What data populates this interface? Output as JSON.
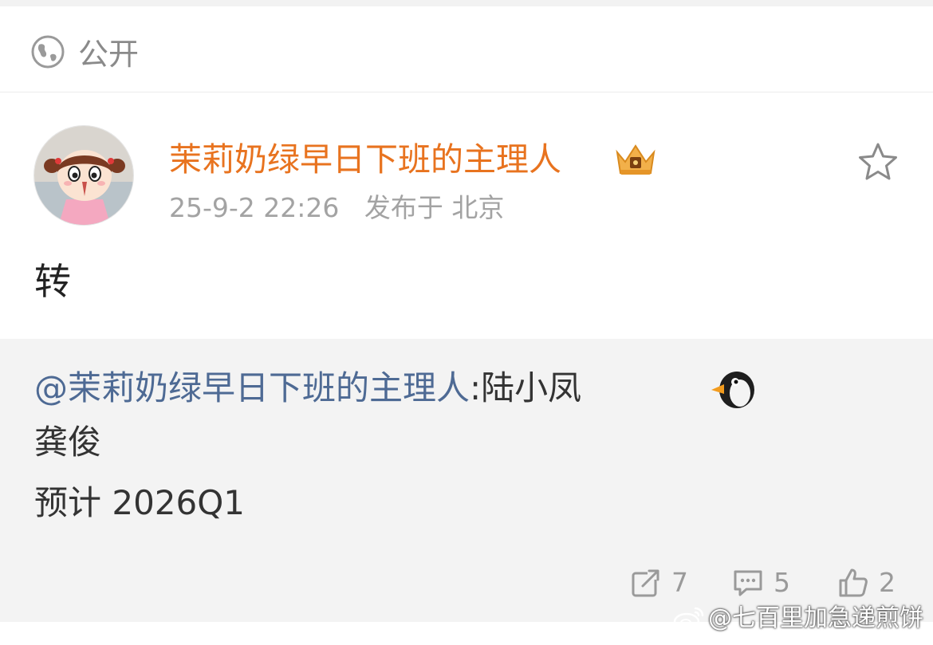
{
  "visibility": {
    "icon": "globe-icon",
    "label": "公开"
  },
  "post": {
    "author": "茉莉奶绿早日下班的主理人",
    "author_color": "#e8731f",
    "badge_icon": "crown-icon",
    "timestamp": "25-9-2 22:26",
    "location": "发布于 北京",
    "text": "转",
    "favorite_icon": "star-icon"
  },
  "repost": {
    "mention": "@茉莉奶绿早日下班的主理人",
    "text": ":陆小凤",
    "emoji": "penguin-emoji",
    "line2": "龚俊",
    "line3": "预计 2026Q1",
    "mention_color": "#4e6a94"
  },
  "actions": {
    "repost_count": "7",
    "comment_count": "5",
    "like_count": "2"
  },
  "watermark": {
    "text": "@七百里加急递煎饼"
  }
}
